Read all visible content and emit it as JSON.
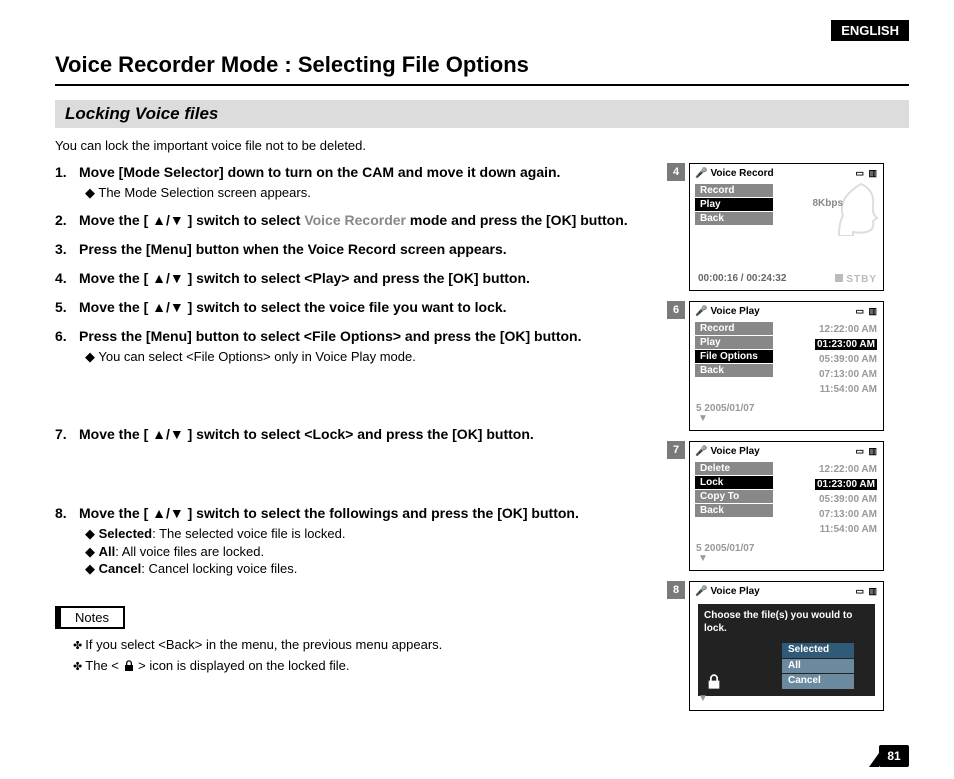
{
  "lang_badge": "ENGLISH",
  "page_title": "Voice Recorder Mode : Selecting File Options",
  "section_title": "Locking Voice files",
  "intro": "You can lock the important voice file not to be deleted.",
  "steps": {
    "s1": "Move [Mode Selector] down to turn on the CAM and move it down again.",
    "s1_sub1": "The Mode Selection screen appears.",
    "s2a": "Move the [ ▲/▼ ] switch to select ",
    "s2b": "Voice Recorder",
    "s2c": " mode and press the [OK] button.",
    "s3": "Press the [Menu] button when the Voice Record screen appears.",
    "s4": "Move the [ ▲/▼ ] switch to select <Play> and press the [OK] button.",
    "s5": "Move the [ ▲/▼ ] switch to select the voice file you want to lock.",
    "s6": "Press the [Menu] button to select <File Options> and press the [OK] button.",
    "s6_sub1": "You can select <File Options> only in Voice Play mode.",
    "s7": "Move the [ ▲/▼ ] switch to select <Lock> and press the [OK] button.",
    "s8": "Move the [ ▲/▼ ] switch to select the followings and press the [OK] button.",
    "s8_sub1a": "Selected",
    "s8_sub1b": ": The selected voice file is locked.",
    "s8_sub2a": "All",
    "s8_sub2b": ": All voice files are locked.",
    "s8_sub3a": "Cancel",
    "s8_sub3b": ": Cancel locking voice files."
  },
  "notes_label": "Notes",
  "notes": {
    "n1": "If you select <Back> in the menu, the previous menu appears.",
    "n2a": "The < ",
    "n2b": " > icon is displayed on the locked file."
  },
  "page_number": "81",
  "screens": {
    "s4": {
      "badge": "4",
      "title": "Voice Record",
      "kbps": "8Kbps",
      "menu": [
        "Record",
        "Play",
        "Back"
      ],
      "menu_sel": 1,
      "time": "00:00:16 / 00:24:32",
      "stby": "STBY"
    },
    "s6": {
      "badge": "6",
      "title": "Voice Play",
      "menu": [
        "Record",
        "Play",
        "File Options",
        "Back"
      ],
      "menu_sel": 2,
      "times": [
        "12:22:00 AM",
        "01:23:00 AM",
        "05:39:00 AM",
        "07:13:00 AM",
        "11:54:00 AM"
      ],
      "times_hl": 1,
      "bottom": "5  2005/01/07"
    },
    "s7": {
      "badge": "7",
      "title": "Voice Play",
      "menu": [
        "Delete",
        "Lock",
        "Copy To",
        "Back"
      ],
      "menu_sel": 1,
      "times": [
        "12:22:00 AM",
        "01:23:00 AM",
        "05:39:00 AM",
        "07:13:00 AM",
        "11:54:00 AM"
      ],
      "times_hl": 1,
      "bottom": "5  2005/01/07"
    },
    "s8": {
      "badge": "8",
      "title": "Voice Play",
      "overlay_text": "Choose the file(s) you would to lock.",
      "options": [
        "Selected",
        "All",
        "Cancel"
      ],
      "options_sel": 0
    }
  }
}
